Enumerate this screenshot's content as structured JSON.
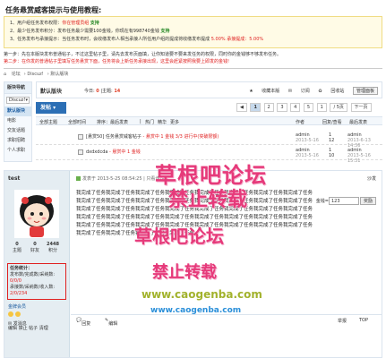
{
  "page_title": "任务悬赏威客提示与使用教程:",
  "notice_lines": [
    {
      "prefix": "1、用户组任务发布权限：",
      "highlight": "你在管理员组",
      "suffix": "支持"
    },
    {
      "prefix": "2、最少任务发布积分：发布任务最少需要100金钱，你现在有998740金钱",
      "highlight": "",
      "suffix": "支持"
    },
    {
      "prefix": "3、任务发布与承接提示：当任务发布时，会收缴发布人相当承接人所任用户组的提成将收缴发布提成",
      "highlight": "5.00%",
      "suffix": "承接提成：5.00%"
    }
  ],
  "steps": [
    "第一步：先在本版块发布普通帖子，不过这里帖子里，请先去发布页面填，让你知道要不要来发任务的权限，同时你的金钱够不够发布任务。",
    "第二步：在你发的普通帖子里填写任务悬赏下面，任务将会上新任务承接出现，这里会赶紧按照我要上即发的金钱!"
  ],
  "breadcrumb": [
    "⌂",
    "论坛",
    "Discuz!",
    "默认版块"
  ],
  "sidebar": {
    "title": "版块导航",
    "select": "Discuz!",
    "items": [
      "默认版块",
      "电影",
      "交友话题",
      "求职招聘",
      "个人求职"
    ]
  },
  "forum_header": {
    "title": "默认版块",
    "today_label": "今日:",
    "today": "0",
    "topics_label": "|主题:",
    "topics": "14",
    "tools": [
      "收藏本版",
      "订阅",
      "回收站",
      "管理面板"
    ]
  },
  "post_button": "发帖",
  "pager": {
    "prev": "◀",
    "pages": [
      "1",
      "2",
      "3",
      "4",
      "5"
    ],
    "current": "1",
    "next_label": "下一页",
    "page_input": "1",
    "total": "/ 5页"
  },
  "filter_bar": [
    "全部主题",
    "全部时间",
    "排序：最后发表",
    "|",
    "热门",
    "精华",
    "更多"
  ],
  "filter_right": [
    "作者",
    "回复/查看",
    "最后发表"
  ],
  "threads": [
    {
      "title": "[悬赏50] 任务悬赏威客帖子",
      "tag": "- 悬赏中 1 金钱 3/3 进行中(突破限额)",
      "author": "admin",
      "date": "2013-5-16",
      "replies": "1",
      "views": "12",
      "last_user": "admin",
      "last_date": "2013-6-13 14:36"
    },
    {
      "title": "dxdxdcda",
      "tag": "- 悬赏中 1 金钱",
      "author": "admin",
      "date": "2013-5-16",
      "replies": "1",
      "views": "10",
      "last_user": "admin",
      "last_date": "2013-5-16 15:31"
    }
  ],
  "watermark": {
    "line1": "草根吧论坛",
    "line2": "禁止转载",
    "line3": "草根吧论坛",
    "line4": "禁止转载",
    "url1": "www.caogenba.com",
    "url2": "www.caogenba.com"
  },
  "post": {
    "username": "test",
    "stats": [
      {
        "num": "0",
        "label": "主题"
      },
      {
        "num": "0",
        "label": "好友"
      },
      {
        "num": "2448",
        "label": "积分"
      }
    ],
    "task_title": "任务统计：",
    "task_lines": [
      {
        "label": "发布数/完成数/采纳数:",
        "value": "0/0/0"
      },
      {
        "label": "承接数/采纳数/收入数:",
        "value": "2/0/234"
      }
    ],
    "rank": "金牌会员",
    "send_msg": "发消息",
    "user_actions": "编辑 禁止 帖子 清理",
    "meta_text": "发表于 2013-5-25 08:54:25",
    "meta_link": "| 只看该作者",
    "floor": "沙发",
    "body": "我完成了任务我完成了任务我完成了任务我完成了任务我完成了任务我完成了任务我完成了任务我完成了任务我完成了任务我完成了任务我完成了任务我完成了任务我完成了任务我完成了任务我完成了任务我完成了任务我完成了任务我完成了任务我完成了任务我完成了任务我完成了任务我完成了任务我完成了任务我完成了任务我完成了任务我完成了任务我完成了任务我完成了任务我完成了任务我完成了任务我完成了任务我完成了任务我完成了任务我完成了任务我完成了任务我完成了任务我完成了任务我完成了任务我完成了任务我完成了任务我完成了任务我完成了任务我完成了任务我完成了任务",
    "reward_label": "金钱=",
    "reward_value": "123",
    "reward_button": "奖励",
    "reply": "回复",
    "edit": "编辑",
    "report": "举报",
    "top": "TOP"
  }
}
